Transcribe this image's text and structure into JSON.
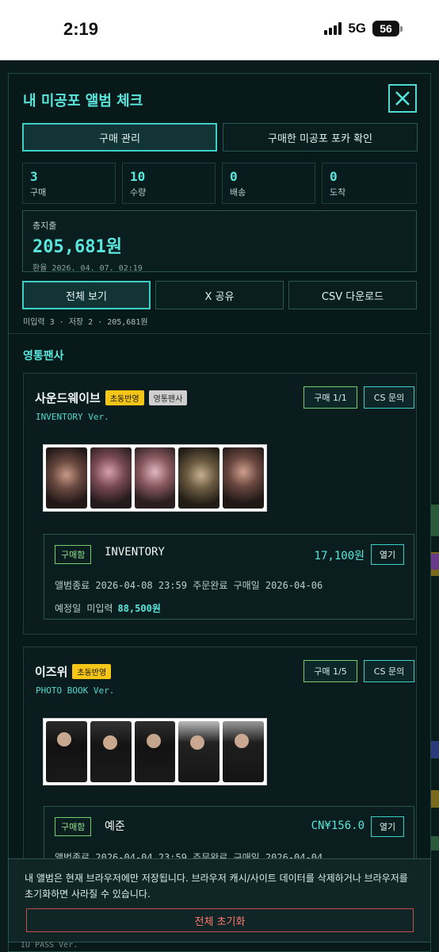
{
  "status_bar": {
    "time": "2:19",
    "network": "5G",
    "battery": "56"
  },
  "modal": {
    "title": "내 미공포 앨범 체크",
    "tabs": [
      "구매 관리",
      "구매한 미공포 포카 확인"
    ],
    "stats": [
      {
        "value": "3",
        "label": "구매"
      },
      {
        "value": "10",
        "label": "수량"
      },
      {
        "value": "0",
        "label": "배송"
      },
      {
        "value": "0",
        "label": "도착"
      }
    ],
    "total": {
      "label": "총지출",
      "value": "205,681원",
      "rate": "환율 2026. 04. 07. 02:19"
    },
    "actions": [
      "전체 보기",
      "X 공유",
      "CSV 다운로드"
    ],
    "summary": "미입력 3 · 저장 2 · 205,681원",
    "section_title": "영통팬사"
  },
  "cards": [
    {
      "name": "사운드웨이브",
      "badges": [
        "초동반영",
        "영통팬사"
      ],
      "version": "INVENTORY Ver.",
      "buy_pill": "구매 1/1",
      "cs_pill": "CS 문의",
      "order": {
        "tag": "구매함",
        "title": "INVENTORY",
        "price": "17,100원",
        "open": "열기",
        "meta": "앨범종료 2026-04-08 23:59  주문완료  구매일 2026-04-06",
        "due_label": "예정일 미입력",
        "due_amount": "88,500원"
      }
    },
    {
      "name": "이즈위",
      "badges": [
        "초동반영"
      ],
      "version": "PHOTO BOOK Ver.",
      "buy_pill": "구매 1/5",
      "cs_pill": "CS 문의",
      "order": {
        "tag": "구매함",
        "title": "예준",
        "price": "CN¥156.0",
        "open": "열기",
        "meta": "앨범종료 2026-04-04 23:59  주문완료  구매일 2026-04-04"
      }
    }
  ],
  "notice": {
    "text": "내 앨범은 현재 브라우저에만 저장됩니다. 브라우저 캐시/사이트 데이터를 삭제하거나 브라우저를 초기화하면 사라질 수 있습니다.",
    "reset": "전체 초기화"
  },
  "peek_text": "IU PASS Ver.",
  "colors": {
    "accent": "#59e6dc",
    "background": "#08191a",
    "badge_yellow": "#f5c518",
    "buy_green": "#6fcf6f",
    "danger": "#ff7a70"
  }
}
